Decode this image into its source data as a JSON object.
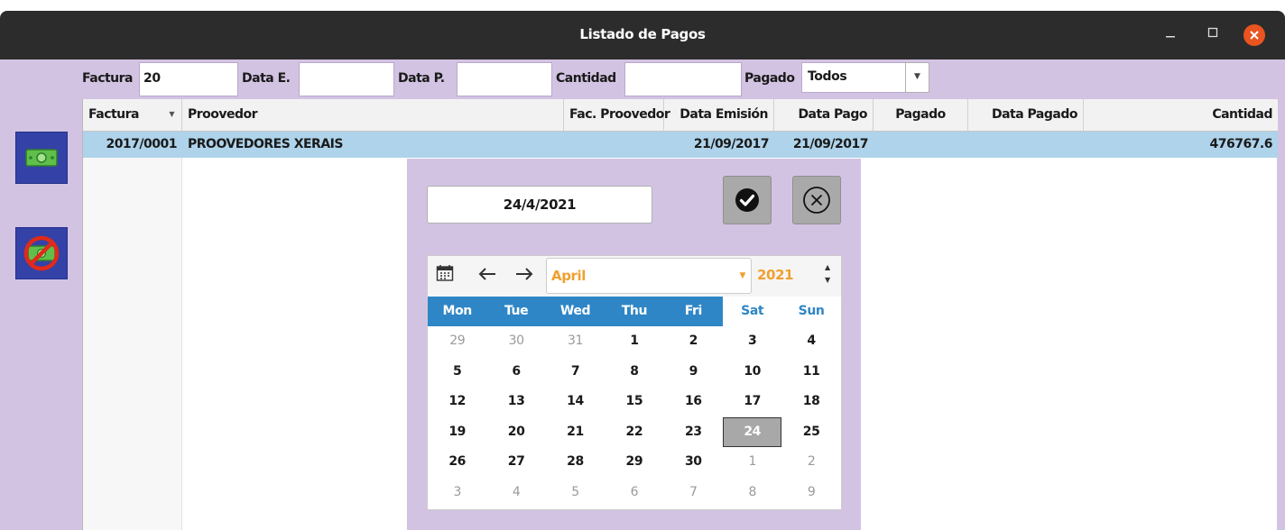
{
  "window": {
    "title": "Listado de Pagos"
  },
  "filters": {
    "factura_label": "Factura",
    "factura_value": "20",
    "data_e_label": "Data E.",
    "data_e_value": "",
    "data_p_label": "Data P.",
    "data_p_value": "",
    "cantidad_label": "Cantidad",
    "cantidad_value": "",
    "pagado_label": "Pagado",
    "pagado_value": "Todos"
  },
  "table": {
    "columns": [
      "Factura",
      "Proovedor",
      "Fac. Proovedor",
      "Data Emisión",
      "Data Pago",
      "Pagado",
      "Data Pagado",
      "Cantidad"
    ],
    "rows": [
      {
        "factura": "2017/0001",
        "proovedor": "PROOVEDORES XERAIS",
        "fac_proovedor": "",
        "data_emision": "21/09/2017",
        "data_pago": "21/09/2017",
        "pagado": "",
        "data_pagado": "",
        "cantidad": "476767.6"
      }
    ]
  },
  "datepicker": {
    "value": "24/4/2021",
    "month": "April",
    "year": "2021",
    "weekdays": [
      "Mon",
      "Tue",
      "Wed",
      "Thu",
      "Fri",
      "Sat",
      "Sun"
    ],
    "weeks": [
      [
        "29",
        "30",
        "31",
        "1",
        "2",
        "3",
        "4"
      ],
      [
        "5",
        "6",
        "7",
        "8",
        "9",
        "10",
        "11"
      ],
      [
        "12",
        "13",
        "14",
        "15",
        "16",
        "17",
        "18"
      ],
      [
        "19",
        "20",
        "21",
        "22",
        "23",
        "24",
        "25"
      ],
      [
        "26",
        "27",
        "28",
        "29",
        "30",
        "1",
        "2"
      ],
      [
        "3",
        "4",
        "5",
        "6",
        "7",
        "8",
        "9"
      ]
    ],
    "selected_day": "24"
  },
  "icons": {
    "side_button_1": "money-icon",
    "side_button_2": "no-money-icon",
    "ok": "check-circle-icon",
    "cancel": "close-circle-icon",
    "calendar": "calendar-icon",
    "prev": "arrow-left-icon",
    "next": "arrow-right-icon"
  },
  "colors": {
    "window_bg": "#d3c3e3",
    "titlebar_bg": "#2c2c2c",
    "close_btn": "#e95420",
    "selected_row": "#aed3ea",
    "calendar_header": "#2f86c6",
    "month_text": "#f0a030"
  }
}
